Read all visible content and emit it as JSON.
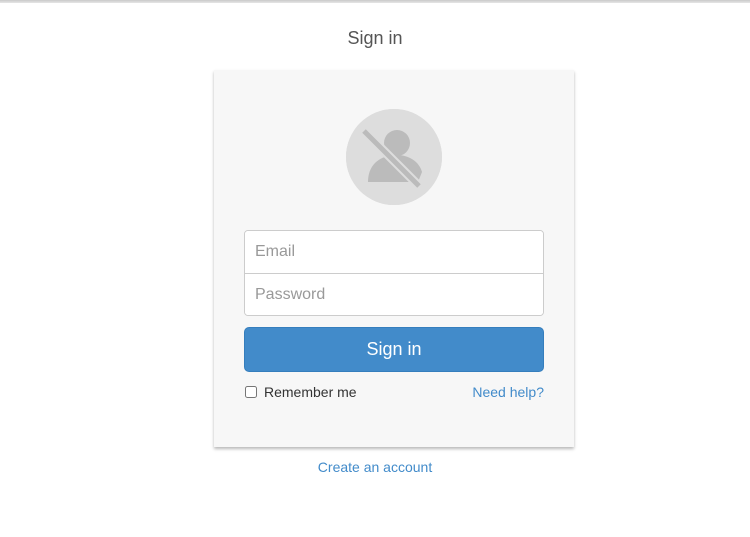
{
  "page": {
    "title": "Sign in"
  },
  "form": {
    "email": {
      "value": "",
      "placeholder": "Email"
    },
    "password": {
      "value": "",
      "placeholder": "Password"
    },
    "submit_label": "Sign in",
    "remember_label": "Remember me",
    "remember_checked": false,
    "help_label": "Need help?"
  },
  "footer": {
    "create_account_label": "Create an account"
  },
  "icons": {
    "avatar": "user-placeholder-icon"
  },
  "colors": {
    "accent": "#428bca",
    "card_background": "#f7f7f7",
    "avatar_background": "#dddddd",
    "avatar_glyph": "#bbbbbb",
    "title_text": "#555555"
  }
}
